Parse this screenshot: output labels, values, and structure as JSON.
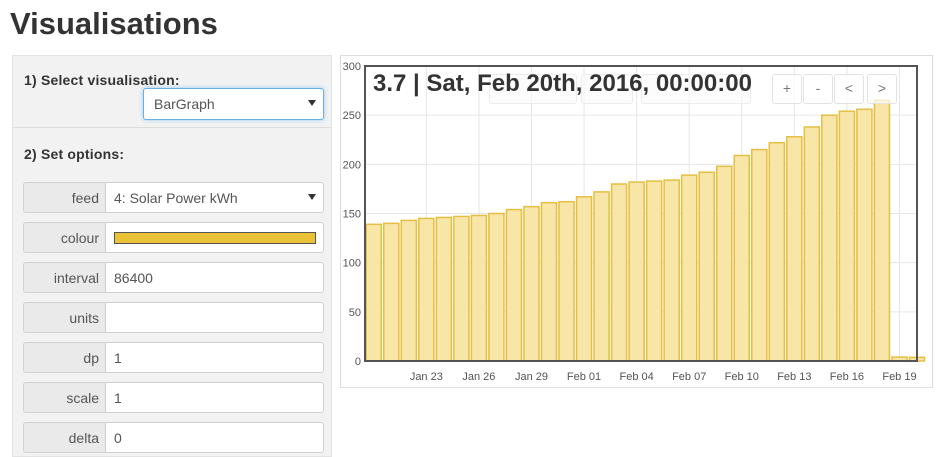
{
  "page": {
    "title": "Visualisations"
  },
  "sidebar": {
    "select_title": "1) Select visualisation:",
    "visualisation_value": "BarGraph",
    "options_title": "2) Set options:",
    "options": [
      {
        "label": "feed",
        "value": "4: Solar Power kWh",
        "type": "select"
      },
      {
        "label": "colour",
        "value": "",
        "type": "colour"
      },
      {
        "label": "interval",
        "value": "86400",
        "type": "text"
      },
      {
        "label": "units",
        "value": "",
        "type": "text"
      },
      {
        "label": "dp",
        "value": "1",
        "type": "text"
      },
      {
        "label": "scale",
        "value": "1",
        "type": "text"
      },
      {
        "label": "delta",
        "value": "0",
        "type": "text"
      }
    ]
  },
  "colors": {
    "bar_colour": "#e9c237",
    "bar_fill": "#f8e5a8",
    "bar_stroke": "#e5bf42"
  },
  "chart": {
    "readout": "3.7 | Sat, Feb 20th, 2016, 00:00:00",
    "controls": {
      "zoom_in": "+",
      "zoom_out": "-",
      "pan_left": "<",
      "pan_right": ">"
    }
  },
  "chart_data": {
    "type": "bar",
    "x": [
      "Jan 20",
      "Jan 21",
      "Jan 22",
      "Jan 23",
      "Jan 24",
      "Jan 25",
      "Jan 26",
      "Jan 27",
      "Jan 28",
      "Jan 29",
      "Jan 30",
      "Jan 31",
      "Feb 01",
      "Feb 02",
      "Feb 03",
      "Feb 04",
      "Feb 05",
      "Feb 06",
      "Feb 07",
      "Feb 08",
      "Feb 09",
      "Feb 10",
      "Feb 11",
      "Feb 12",
      "Feb 13",
      "Feb 14",
      "Feb 15",
      "Feb 16",
      "Feb 17",
      "Feb 18",
      "Feb 19",
      "Feb 20"
    ],
    "values": [
      139,
      140,
      143,
      145,
      146,
      147,
      148,
      150,
      154,
      157,
      161,
      162,
      167,
      172,
      180,
      182,
      183,
      184,
      189,
      192,
      198,
      209,
      215,
      222,
      228,
      238,
      250,
      254,
      256,
      265,
      4,
      3.7
    ],
    "value_labels": [
      "139",
      "140",
      "143",
      "145",
      "146",
      "147",
      "148",
      "150",
      "154",
      "157",
      "161",
      "162",
      "167",
      "172",
      "180",
      "182",
      "183",
      "184",
      "189",
      "192",
      "198",
      "209",
      "215",
      "222",
      "228",
      "238",
      "250",
      "254",
      "256",
      "265",
      "4",
      "3.7"
    ],
    "xticks": [
      "Jan 23",
      "Jan 26",
      "Jan 29",
      "Feb 01",
      "Feb 04",
      "Feb 07",
      "Feb 10",
      "Feb 13",
      "Feb 16",
      "Feb 19"
    ],
    "ylim": [
      0,
      300
    ],
    "yticks": [
      "0",
      "50",
      "100",
      "150",
      "200",
      "250",
      "300"
    ],
    "grid": true
  }
}
